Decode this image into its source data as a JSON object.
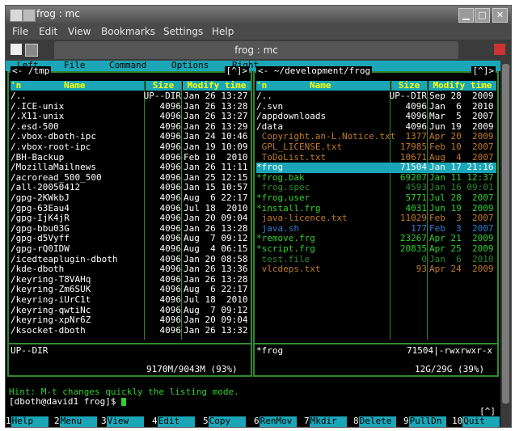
{
  "window": {
    "title": "frog : mc",
    "tab_title": "frog : mc"
  },
  "menubar": [
    "File",
    "Edit",
    "View",
    "Bookmarks",
    "Settings",
    "Help"
  ],
  "mc_menu": [
    "Left",
    "File",
    "Command",
    "Options",
    "Right"
  ],
  "left_panel": {
    "path": "<- /tmp",
    "corner": "[^]>",
    "headers": {
      "name": "Name",
      "size": "Size",
      "mtime": "Modify time",
      "n": "'n"
    },
    "rows": [
      {
        "name": "/..",
        "size": "UP--DIR",
        "mtime": "Jan 26 13:27"
      },
      {
        "name": "/.ICE-unix",
        "size": "4096",
        "mtime": "Jan 26 13:28"
      },
      {
        "name": "/.X11-unix",
        "size": "4096",
        "mtime": "Jan 26 13:27"
      },
      {
        "name": "/.esd-500",
        "size": "4096",
        "mtime": "Jan 26 13:29"
      },
      {
        "name": "/.vbox-dboth-ipc",
        "size": "4096",
        "mtime": "Jan 24 10:46"
      },
      {
        "name": "/.vbox-root-ipc",
        "size": "4096",
        "mtime": "Jan 19 10:09"
      },
      {
        "name": "/BH-Backup",
        "size": "4096",
        "mtime": "Feb 10  2010"
      },
      {
        "name": "/MozillaMailnews",
        "size": "4096",
        "mtime": "Jan 26 11:11"
      },
      {
        "name": "/acroread_500_500",
        "size": "4096",
        "mtime": "Jan 25 12:15"
      },
      {
        "name": "/all-20050412",
        "size": "4096",
        "mtime": "Jan 15 10:57"
      },
      {
        "name": "/gpg-2KWkbJ",
        "size": "4096",
        "mtime": "Aug  6 22:17"
      },
      {
        "name": "/gpg-63Eau4",
        "size": "4096",
        "mtime": "Jul 18  2010"
      },
      {
        "name": "/gpg-IjK4jR",
        "size": "4096",
        "mtime": "Jan 20 09:04"
      },
      {
        "name": "/gpg-bbu03G",
        "size": "4096",
        "mtime": "Jan 26 13:28"
      },
      {
        "name": "/gpg-d5Vyff",
        "size": "4096",
        "mtime": "Aug  7 09:12"
      },
      {
        "name": "/gpg-rQ0IDW",
        "size": "4096",
        "mtime": "Aug  4 06:15"
      },
      {
        "name": "/icedteaplugin-dboth",
        "size": "4096",
        "mtime": "Jan 20 08:58"
      },
      {
        "name": "/kde-dboth",
        "size": "4096",
        "mtime": "Jan 26 13:36"
      },
      {
        "name": "/keyring-T8VAHq",
        "size": "4096",
        "mtime": "Jan 26 13:28"
      },
      {
        "name": "/keyring-Zm6SUK",
        "size": "4096",
        "mtime": "Aug  6 22:17"
      },
      {
        "name": "/keyring-iUrC1t",
        "size": "4096",
        "mtime": "Jul 18  2010"
      },
      {
        "name": "/keyring-qwtiNc",
        "size": "4096",
        "mtime": "Aug  7 09:12"
      },
      {
        "name": "/keyring-xpNr6Z",
        "size": "4096",
        "mtime": "Jan 20 09:04"
      },
      {
        "name": "/ksocket-dboth",
        "size": "4096",
        "mtime": "Jan 26 13:32"
      }
    ],
    "info": "UP--DIR",
    "free": "9170M/9043M (93%)"
  },
  "right_panel": {
    "path": "<- ~/development/frog",
    "corner": "[^]>",
    "headers": {
      "name": "Name",
      "size": "Size",
      "mtime": "Modify time",
      "n": "'n"
    },
    "rows": [
      {
        "name": "/..",
        "size": "UP--DIR",
        "mtime": "Sep 28  2009",
        "kind": "dir"
      },
      {
        "name": "/.svn",
        "size": "4096",
        "mtime": "Jan  6  2010",
        "kind": "dir"
      },
      {
        "name": "/appdownloads",
        "size": "4096",
        "mtime": "Mar  5  2007",
        "kind": "dir"
      },
      {
        "name": "/data",
        "size": "4096",
        "mtime": "Jun 19  2009",
        "kind": "dir"
      },
      {
        "name": " Copyright.an-L.Notice.txt",
        "size": "1377",
        "mtime": "Apr 20  2009",
        "kind": "doc"
      },
      {
        "name": " GPL_LICENSE.txt",
        "size": "17985",
        "mtime": "Feb 10  2007",
        "kind": "doc"
      },
      {
        "name": " ToDoList.txt",
        "size": "10671",
        "mtime": "Aug  4  2007",
        "kind": "doc"
      },
      {
        "name": "*frog",
        "size": "71504",
        "mtime": "Jan 17 21:16",
        "kind": "selected"
      },
      {
        "name": "*frog.bak",
        "size": "69207",
        "mtime": "Jan 11 12:37",
        "kind": "exec"
      },
      {
        "name": " frog.spec",
        "size": "4593",
        "mtime": "Jan 16 09:01",
        "kind": "spec"
      },
      {
        "name": "*frog.user",
        "size": "5771",
        "mtime": "Jul 28  2007",
        "kind": "exec"
      },
      {
        "name": "*install.frg",
        "size": "4031",
        "mtime": "Jun 19  2009",
        "kind": "exec"
      },
      {
        "name": " java-licence.txt",
        "size": "11029",
        "mtime": "Feb  3  2007",
        "kind": "doc"
      },
      {
        "name": " java.sh",
        "size": "177",
        "mtime": "Feb  3  2007",
        "kind": "script"
      },
      {
        "name": "*remove.frg",
        "size": "23267",
        "mtime": "Apr 21  2009",
        "kind": "exec"
      },
      {
        "name": "*script.frg",
        "size": "20835",
        "mtime": "Apr 25  2009",
        "kind": "exec"
      },
      {
        "name": " test.file",
        "size": "0",
        "mtime": "Jan  6  2010",
        "kind": "spec"
      },
      {
        "name": " vlcdeps.txt",
        "size": "93",
        "mtime": "Apr 24  2009",
        "kind": "doc"
      }
    ],
    "info_name": "*frog",
    "info_detail": "71504|-rwxrwxr-x",
    "free": "12G/29G (39%)"
  },
  "hint": "Hint: M-t changes quickly the listing mode.",
  "prompt": "[dboth@david1 frog]$ ",
  "prompt_corner": "[^]",
  "fkeys": [
    {
      "n": "1",
      "l": "Help"
    },
    {
      "n": "2",
      "l": "Menu"
    },
    {
      "n": "3",
      "l": "View"
    },
    {
      "n": "4",
      "l": "Edit"
    },
    {
      "n": "5",
      "l": "Copy"
    },
    {
      "n": "6",
      "l": "RenMov"
    },
    {
      "n": "7",
      "l": "Mkdir"
    },
    {
      "n": "8",
      "l": "Delete"
    },
    {
      "n": "9",
      "l": "PullDn"
    },
    {
      "n": "10",
      "l": "Quit"
    }
  ],
  "colors": {
    "dir": "#ffffff",
    "exec": "#2fd02f",
    "doc": "#c07a28",
    "spec": "#2a8a2a",
    "script": "#2f7fd0",
    "selected_bg": "#1aa6b7",
    "header_bar": "#1aa6b7"
  }
}
